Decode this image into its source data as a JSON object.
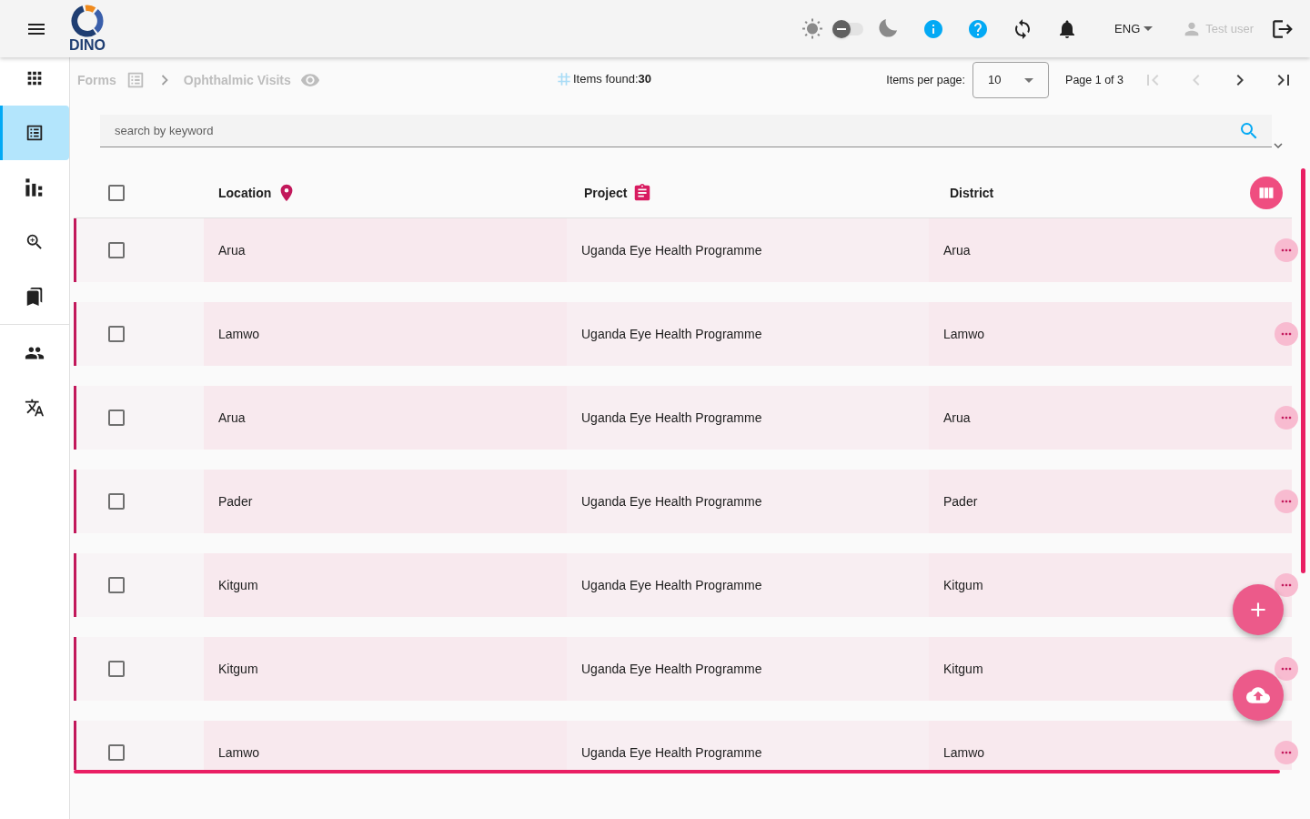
{
  "header": {
    "app_name": "DINO",
    "dark_mode": false,
    "language": "ENG",
    "user": "Test user"
  },
  "sidebar": {
    "groups": [
      {
        "items": [
          {
            "kind": "apps",
            "selected": false
          },
          {
            "kind": "forms",
            "selected": true
          },
          {
            "kind": "stats",
            "selected": false
          },
          {
            "kind": "search",
            "selected": false
          },
          {
            "kind": "bookmarks",
            "selected": false
          }
        ]
      },
      {
        "items": [
          {
            "kind": "users",
            "selected": false
          },
          {
            "kind": "translate",
            "selected": false
          }
        ]
      }
    ]
  },
  "breadcrumb": [
    {
      "label": "Forms",
      "kind": "list"
    },
    {
      "label": "Ophthalmic Visits",
      "kind": "view"
    }
  ],
  "items_found": "Items found:**30**",
  "pagination": {
    "items_per_page_label": "Items per page:",
    "page_size": "10",
    "range": "Page 1 of 3",
    "buttons": [
      {
        "kind": "first",
        "disabled": true
      },
      {
        "kind": "previous",
        "disabled": true
      },
      {
        "kind": "next",
        "disabled": false
      },
      {
        "kind": "last",
        "disabled": false
      }
    ]
  },
  "search": {
    "placeholder": "search by keyword"
  },
  "table": {
    "all_checked": false,
    "columns": [
      {
        "label": "Location",
        "kind": "location"
      },
      {
        "label": "Project",
        "kind": "project"
      },
      {
        "label": "District",
        "kind": "plain"
      }
    ],
    "rows": [
      {
        "checked": false,
        "cells": [
          "Arua",
          "Uganda Eye Health Programme",
          "Arua"
        ]
      },
      {
        "checked": false,
        "cells": [
          "Lamwo",
          "Uganda Eye Health Programme",
          "Lamwo"
        ]
      },
      {
        "checked": false,
        "cells": [
          "Arua",
          "Uganda Eye Health Programme",
          "Arua"
        ]
      },
      {
        "checked": false,
        "cells": [
          "Pader",
          "Uganda Eye Health Programme",
          "Pader"
        ]
      },
      {
        "checked": false,
        "cells": [
          "Kitgum",
          "Uganda Eye Health Programme",
          "Kitgum"
        ]
      },
      {
        "checked": false,
        "cells": [
          "Kitgum",
          "Uganda Eye Health Programme",
          "Kitgum"
        ]
      },
      {
        "checked": false,
        "cells": [
          "Lamwo",
          "Uganda Eye Health Programme",
          "Lamwo"
        ]
      }
    ]
  },
  "actions": [
    {
      "kind": "add"
    },
    {
      "kind": "upload"
    }
  ]
}
